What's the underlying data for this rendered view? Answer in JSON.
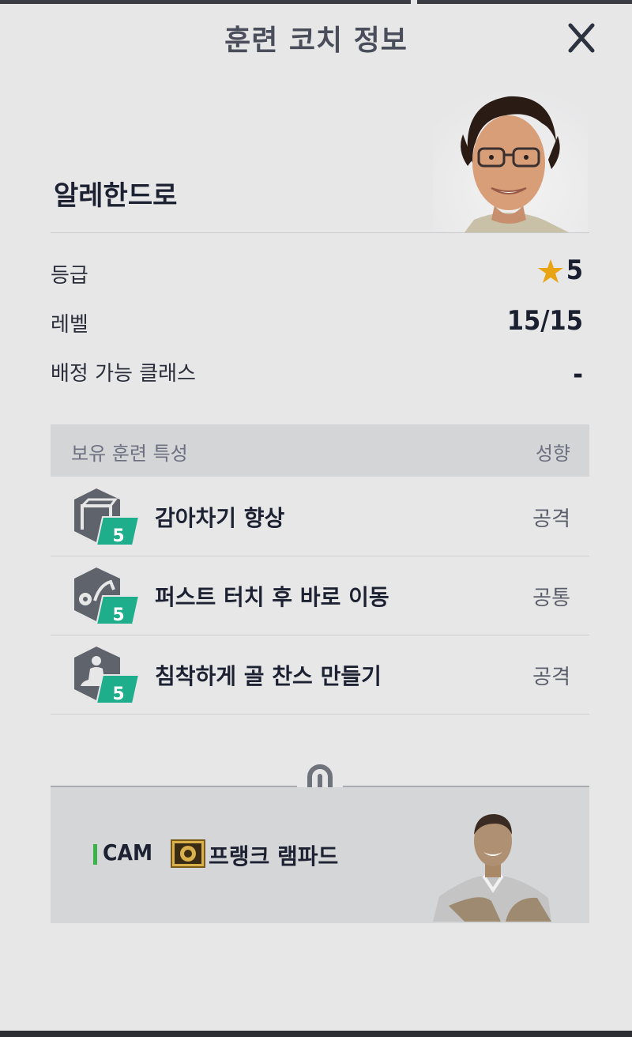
{
  "header": {
    "title": "훈련 코치 정보"
  },
  "coach": {
    "name": "알레한드로"
  },
  "info": [
    {
      "label": "등급",
      "value": "5"
    },
    {
      "label": "레벨",
      "value": "15/15"
    },
    {
      "label": "배정 가능 클래스",
      "value": "-"
    }
  ],
  "traits": {
    "header_left": "보유 훈련 특성",
    "header_right": "성향",
    "items": [
      {
        "level": "5",
        "name": "감아차기 향상",
        "type": "공격"
      },
      {
        "level": "5",
        "name": "퍼스트 터치 후 바로 이동",
        "type": "공통"
      },
      {
        "level": "5",
        "name": "침착하게 골 찬스 만들기",
        "type": "공격"
      }
    ]
  },
  "linked_player": {
    "position": "CAM",
    "name": "프랭크 램파드"
  },
  "colors": {
    "star": "#e8a412",
    "badge_green": "#1fae8c",
    "icon_gray": "#5f636c",
    "position_bar": "#3bb34a"
  }
}
